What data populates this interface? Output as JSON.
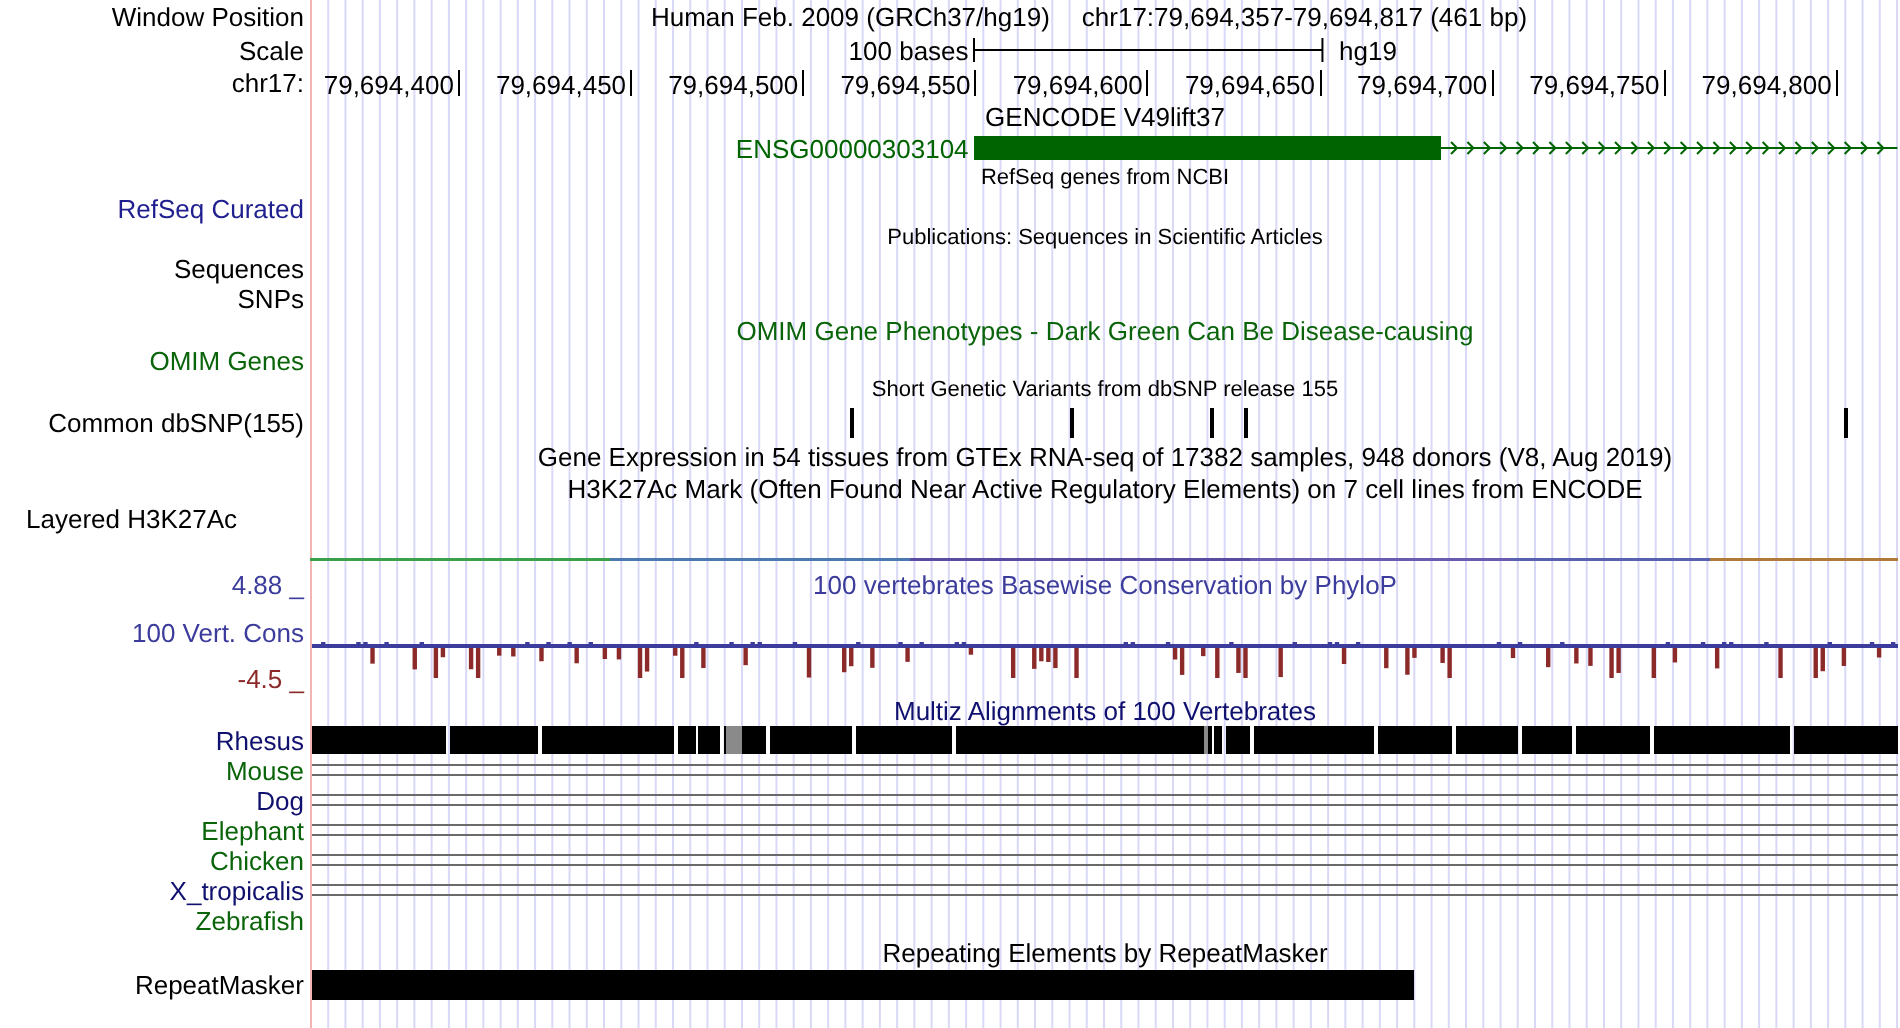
{
  "position": {
    "label": "Window Position",
    "assembly": "Human Feb. 2009 (GRCh37/hg19)",
    "range": "chr17:79,694,357-79,694,817 (461 bp)"
  },
  "scale": {
    "label": "Scale",
    "length": "100 bases",
    "assembly": "hg19"
  },
  "ruler": {
    "label": "chr17:",
    "ticks": [
      "79,694,400",
      "79,694,450",
      "79,694,500",
      "79,694,550",
      "79,694,600",
      "79,694,650",
      "79,694,700",
      "79,694,750",
      "79,694,800"
    ]
  },
  "tracks": [
    {
      "kind": "title",
      "text": "GENCODE V49lift37",
      "color": "#000000"
    },
    {
      "kind": "gene",
      "item": "ENSG00000303104",
      "color": "#006400"
    },
    {
      "kind": "caption",
      "text": "RefSeq genes from NCBI"
    },
    {
      "kind": "label",
      "label": "RefSeq Curated",
      "color": "#1f1f8f"
    },
    {
      "kind": "caption",
      "text": "Publications: Sequences in Scientific Articles"
    },
    {
      "kind": "label",
      "label": "Sequences",
      "color": "#000000"
    },
    {
      "kind": "label",
      "label": "SNPs",
      "color": "#000000"
    },
    {
      "kind": "title",
      "text": "OMIM Gene Phenotypes - Dark Green Can Be Disease-causing",
      "color": "#0a640a"
    },
    {
      "kind": "label",
      "label": "OMIM Genes",
      "color": "#0a640a"
    },
    {
      "kind": "caption",
      "text": "Short Genetic Variants from dbSNP release 155"
    },
    {
      "kind": "snps",
      "label": "Common dbSNP(155)",
      "color": "#000000"
    },
    {
      "kind": "title",
      "text": "Gene Expression in 54 tissues from GTEx RNA-seq of 17382 samples, 948 donors (V8, Aug 2019)",
      "color": "#000000"
    },
    {
      "kind": "title",
      "text": "H3K27Ac Mark (Often Found Near Active Regulatory Elements) on 7 cell lines from ENCODE",
      "color": "#000000"
    },
    {
      "kind": "layered",
      "label": "Layered H3K27Ac",
      "color": "#000000"
    },
    {
      "kind": "wiggle",
      "title": "100 vertebrates Basewise Conservation by PhyloP",
      "label": "100 Vert. Cons",
      "max": "4.88 _",
      "color": "#3c3c9c",
      "min": {
        "text": "-4.5 _",
        "color": "#8c2a2a"
      }
    },
    {
      "kind": "title",
      "text": "Multiz Alignments of 100 Vertebrates",
      "color": "#10106e"
    },
    {
      "kind": "block",
      "label": "Rhesus",
      "color": "#10106e"
    },
    {
      "kind": "lines",
      "label": "Mouse",
      "color": "#0a640a"
    },
    {
      "kind": "lines",
      "label": "Dog",
      "color": "#10106e"
    },
    {
      "kind": "lines",
      "label": "Elephant",
      "color": "#0a640a"
    },
    {
      "kind": "lines",
      "label": "Chicken",
      "color": "#0a640a"
    },
    {
      "kind": "lines",
      "label": "X_tropicalis",
      "color": "#10106e"
    },
    {
      "kind": "label",
      "label": "Zebrafish",
      "color": "#0a640a"
    },
    {
      "kind": "title",
      "text": "Repeating Elements by RepeatMasker",
      "color": "#000000"
    },
    {
      "kind": "repeats",
      "label": "RepeatMasker",
      "color": "#000000"
    }
  ]
}
